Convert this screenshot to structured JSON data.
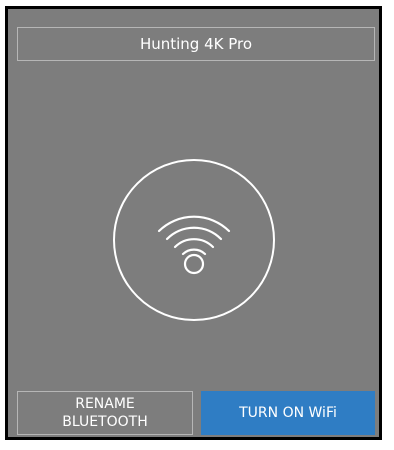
{
  "device": {
    "title": "Hunting 4K Pro"
  },
  "status_icon": "wifi-icon",
  "buttons": {
    "rename_line1": "RENAME",
    "rename_line2": "BLUETOOTH",
    "wifi_label": "TURN ON WiFi"
  },
  "colors": {
    "panel_bg": "#7d7d7d",
    "accent": "#2f7dc4",
    "text": "#ffffff",
    "outline": "#b6b6b6"
  }
}
